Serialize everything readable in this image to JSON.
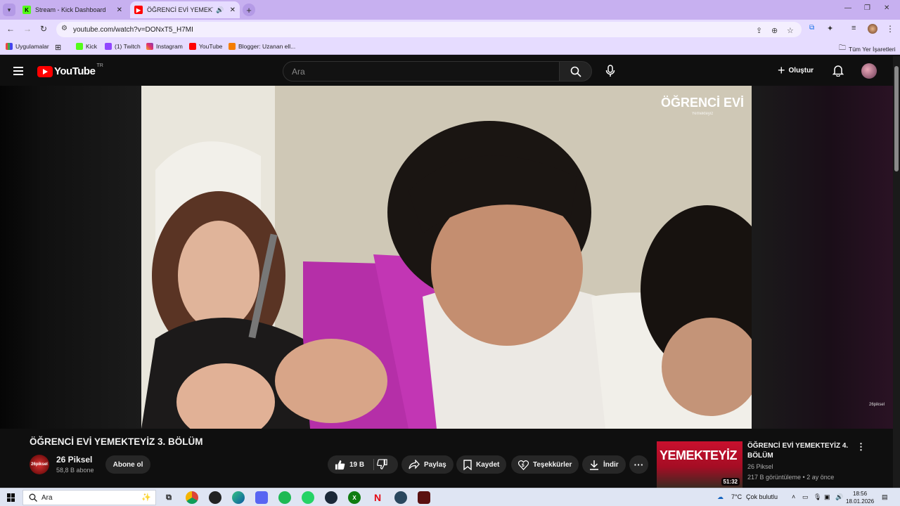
{
  "browser": {
    "tabs": [
      {
        "title": "Stream - Kick Dashboard",
        "active": false
      },
      {
        "title": "ÖĞRENCİ EVİ YEMEKTEYİZ",
        "active": true
      }
    ],
    "url": "youtube.com/watch?v=DONxT5_H7MI",
    "bookmarks": [
      {
        "label": "Uygulamalar"
      },
      {
        "label": "Kick"
      },
      {
        "label": "(1) Twitch"
      },
      {
        "label": "Instagram"
      },
      {
        "label": "YouTube"
      },
      {
        "label": "Blogger: Uzanan ell..."
      }
    ],
    "all_bookmarks": "Tüm Yer İşaretleri",
    "colors": {
      "frame": "#c7b0f0",
      "toolbar": "#e6dcff"
    }
  },
  "youtube": {
    "logo_text": "YouTube",
    "country": "TR",
    "search_placeholder": "Ara",
    "create_label": "Oluştur",
    "accent": "#ff0000"
  },
  "video": {
    "watermark": "ÖĞRENCİ EVİ",
    "watermark_sub": "Yemekteyiz",
    "corner_mark": "26piksel",
    "title": "ÖĞRENCİ EVİ YEMEKTEYİZ 3. BÖLÜM",
    "channel": "26 Piksel",
    "channel_avatar_text": "26piksel",
    "subscribers": "58,8 B abone",
    "subscribe_label": "Abone ol",
    "likes": "19 B",
    "share_label": "Paylaş",
    "save_label": "Kaydet",
    "thanks_label": "Teşekkürler",
    "download_label": "İndir"
  },
  "recommendation": {
    "title": "ÖĞRENCİ EVİ YEMEKTEYİZ 4. BÖLÜM",
    "channel": "26 Piksel",
    "meta": "217 B görüntüleme • 2 ay önce",
    "duration": "51:32",
    "thumb_text": "YEMEKTEYİZ"
  },
  "taskbar": {
    "search_placeholder": "Ara",
    "weather": "7°C",
    "weather_desc": "Çok bulutlu",
    "time": "18:56",
    "date": "18.01.2026"
  }
}
